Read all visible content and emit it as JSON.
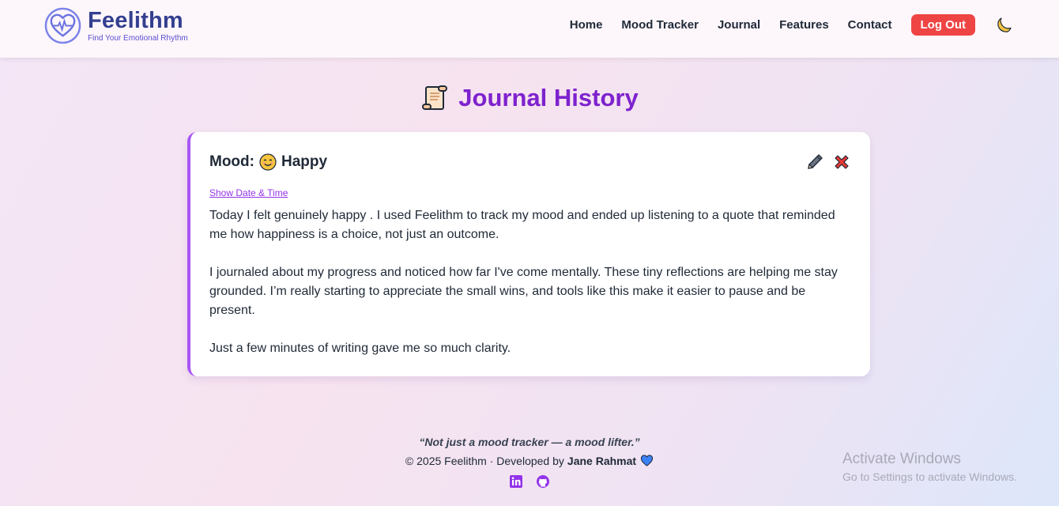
{
  "brand": {
    "name": "Feelithm",
    "tagline": "Find Your Emotional Rhythm"
  },
  "nav": {
    "items": [
      "Home",
      "Mood Tracker",
      "Journal",
      "Features",
      "Contact"
    ],
    "logout_label": "Log Out",
    "theme_icon": "moon-icon"
  },
  "page": {
    "title": "Journal History",
    "title_icon": "scroll-icon"
  },
  "entry": {
    "mood_label": "Mood:",
    "mood_emoji": "smiling-face-icon",
    "mood_value": "Happy",
    "show_date_label": "Show Date & Time",
    "paragraphs": [
      "Today I felt genuinely happy . I used Feelithm to track my mood and ended up listening to a quote that reminded me how happiness is a choice, not just an outcome.",
      "I journaled about my progress and noticed how far I've come mentally. These tiny reflections are helping me stay grounded. I’m really starting to appreciate the small wins, and tools like this make it easier to pause and be present.",
      "Just a few minutes of writing gave me so much clarity."
    ]
  },
  "footer": {
    "quote": "“Not just a mood tracker — a mood lifter.”",
    "copyright": "© 2025 Feelithm · Developed by",
    "author": "Jane Rahmat"
  },
  "watermark": {
    "title": "Activate Windows",
    "subtitle": "Go to Settings to activate Windows."
  },
  "colors": {
    "accent": "#7e22ce",
    "card_border": "#a855f7",
    "logout": "#ef4444",
    "brand": "#34408f"
  }
}
